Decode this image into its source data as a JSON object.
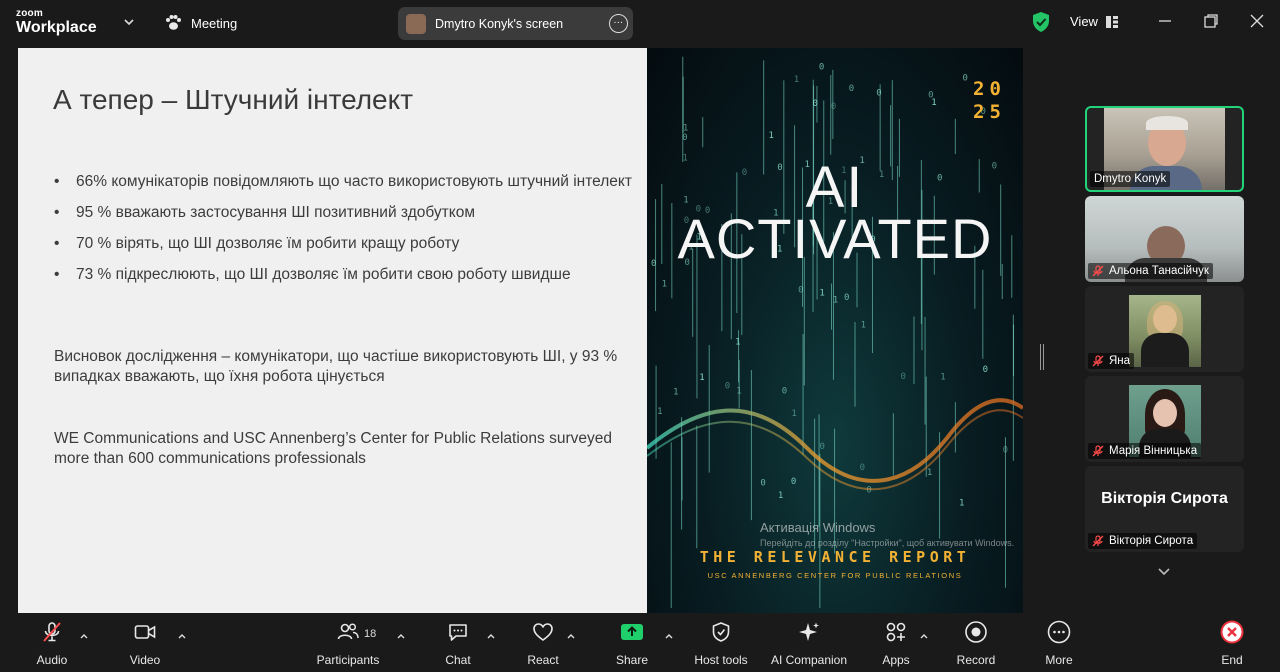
{
  "app": {
    "logo_top": "zoom",
    "logo_bottom": "Workplace",
    "meeting_label": "Meeting"
  },
  "share_pill": {
    "label": "Dmytro Konyk's screen"
  },
  "header": {
    "view_label": "View"
  },
  "slide": {
    "title": "А тепер – Штучний інтелект",
    "bullets": [
      "66% комунікаторів повідомляють що часто використовують штучний інтелект",
      "95 % вважають застосування ШІ позитивний здобутком",
      "70 % вірять, що ШІ дозволяє їм робити кращу роботу",
      "73 % підкреслюють, що ШІ дозволяє їм робити свою роботу швидше"
    ],
    "conclusion": "Висновок дослідження – комунікатори, що частіше використовують ШІ, у 93 % випадках вважають, що їхня робота цінується",
    "source": "WE Communications and USC Annenberg’s Center for Public Relations surveyed more than 600 communications professionals",
    "cover": {
      "year_top": "20",
      "year_bottom": "25",
      "headline_1": "AI",
      "headline_2": "ACTIVATED",
      "report_title": "THE RELEVANCE REPORT",
      "report_sub": "USC ANNENBERG CENTER FOR PUBLIC RELATIONS"
    },
    "watermark": {
      "line1": "Активація Windows",
      "line2": "Перейдіть до розділу \"Настройки\", щоб активувати Windows."
    }
  },
  "participants": [
    {
      "name": "Dmytro Konyk",
      "muted": false,
      "active": true
    },
    {
      "name": "Альона Танасійчук",
      "muted": true
    },
    {
      "name": "Яна",
      "muted": true
    },
    {
      "name": "Марія Вінницька",
      "muted": true
    },
    {
      "name": "Вікторія Сирота",
      "display_text": "Вікторія Сирота",
      "muted": true
    }
  ],
  "toolbar": {
    "audio": "Audio",
    "video": "Video",
    "participants": "Participants",
    "participants_count": "18",
    "chat": "Chat",
    "react": "React",
    "share": "Share",
    "host_tools": "Host tools",
    "ai_companion": "AI Companion",
    "apps": "Apps",
    "record": "Record",
    "more": "More",
    "end": "End"
  },
  "colors": {
    "accent_green": "#23d37a",
    "share_green": "#1fcf6b",
    "end_red": "#e8323c",
    "cover_gold": "#f3b234"
  }
}
